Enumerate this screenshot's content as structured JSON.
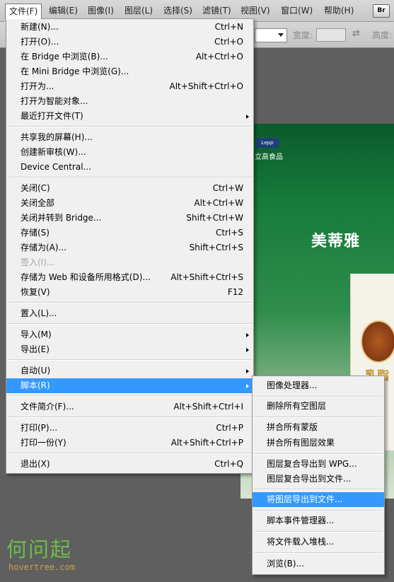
{
  "menubar": {
    "items": [
      "文件(F)",
      "编辑(E)",
      "图像(I)",
      "图层(L)",
      "选择(S)",
      "滤镜(T)",
      "视图(V)",
      "窗口(W)",
      "帮助(H)"
    ],
    "bridge_button": "Br"
  },
  "options_bar": {
    "width_label": "宽度:",
    "height_label": "高度:"
  },
  "document": {
    "logo_text": "Lepp",
    "logo_caption": "立高食品",
    "brand": "美蒂雅",
    "product_text": "乳脂"
  },
  "file_menu": {
    "items": [
      {
        "label": "新建(N)...",
        "shortcut": "Ctrl+N"
      },
      {
        "label": "打开(O)...",
        "shortcut": "Ctrl+O"
      },
      {
        "label": "在 Bridge 中浏览(B)...",
        "shortcut": "Alt+Ctrl+O"
      },
      {
        "label": "在 Mini Bridge 中浏览(G)...",
        "shortcut": ""
      },
      {
        "label": "打开为...",
        "shortcut": "Alt+Shift+Ctrl+O"
      },
      {
        "label": "打开为智能对象...",
        "shortcut": ""
      },
      {
        "label": "最近打开文件(T)",
        "shortcut": ""
      },
      {
        "label": "共享我的屏幕(H)...",
        "shortcut": ""
      },
      {
        "label": "创建新审核(W)...",
        "shortcut": ""
      },
      {
        "label": "Device Central...",
        "shortcut": ""
      },
      {
        "label": "关闭(C)",
        "shortcut": "Ctrl+W"
      },
      {
        "label": "关闭全部",
        "shortcut": "Alt+Ctrl+W"
      },
      {
        "label": "关闭并转到 Bridge...",
        "shortcut": "Shift+Ctrl+W"
      },
      {
        "label": "存储(S)",
        "shortcut": "Ctrl+S"
      },
      {
        "label": "存储为(A)...",
        "shortcut": "Shift+Ctrl+S"
      },
      {
        "label": "签入(I)...",
        "shortcut": ""
      },
      {
        "label": "存储为 Web 和设备所用格式(D)...",
        "shortcut": "Alt+Shift+Ctrl+S"
      },
      {
        "label": "恢复(V)",
        "shortcut": "F12"
      },
      {
        "label": "置入(L)...",
        "shortcut": ""
      },
      {
        "label": "导入(M)",
        "shortcut": ""
      },
      {
        "label": "导出(E)",
        "shortcut": ""
      },
      {
        "label": "自动(U)",
        "shortcut": ""
      },
      {
        "label": "脚本(R)",
        "shortcut": ""
      },
      {
        "label": "文件简介(F)...",
        "shortcut": "Alt+Shift+Ctrl+I"
      },
      {
        "label": "打印(P)...",
        "shortcut": "Ctrl+P"
      },
      {
        "label": "打印一份(Y)",
        "shortcut": "Alt+Shift+Ctrl+P"
      },
      {
        "label": "退出(X)",
        "shortcut": "Ctrl+Q"
      }
    ]
  },
  "scripts_submenu": {
    "items": [
      "图像处理器...",
      "删除所有空图层",
      "拼合所有蒙版",
      "拼合所有图层效果",
      "图层复合导出到 WPG...",
      "图层复合导出到文件...",
      "将图层导出到文件...",
      "脚本事件管理器...",
      "将文件载入堆栈...",
      "浏览(B)..."
    ]
  },
  "watermark": {
    "title": "何问起",
    "url": "hovertree.com"
  }
}
